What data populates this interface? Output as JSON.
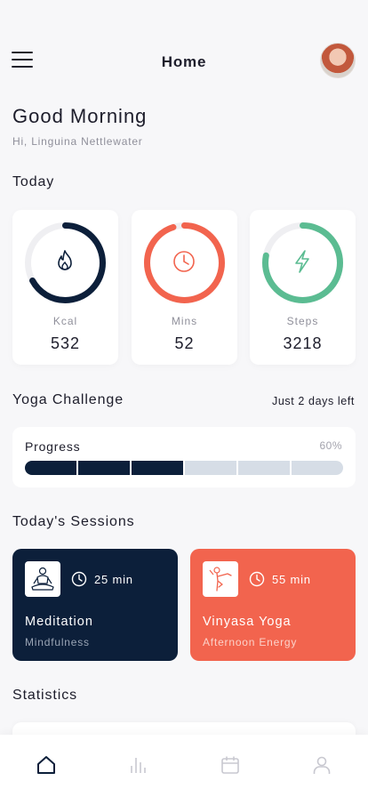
{
  "header": {
    "title": "Home"
  },
  "greeting": {
    "title": "Good Morning",
    "subtitle": "Hi, Linguina Nettlewater"
  },
  "today": {
    "title": "Today",
    "stats": [
      {
        "label": "Kcal",
        "value": "532",
        "icon": "flame-icon",
        "color": "#0c1f3a",
        "fill": 0.67
      },
      {
        "label": "Mins",
        "value": "52",
        "icon": "clock-icon",
        "color": "#f2644e",
        "fill": 0.95
      },
      {
        "label": "Steps",
        "value": "3218",
        "icon": "lightning-icon",
        "color": "#5bbc92",
        "fill": 0.78
      }
    ]
  },
  "challenge": {
    "title": "Yoga Challenge",
    "note": "Just 2 days left",
    "progress_label": "Progress",
    "progress_percent": "60%",
    "segments_total": 6,
    "segments_done": 3
  },
  "sessions": {
    "title": "Today's Sessions",
    "items": [
      {
        "name": "Meditation",
        "subtitle": "Mindfulness",
        "duration": "25 min",
        "icon": "meditation-icon",
        "color": "#0c1f3a"
      },
      {
        "name": "Vinyasa Yoga",
        "subtitle": "Afternoon Energy",
        "duration": "55 min",
        "icon": "yoga-pose-icon",
        "color": "#f2644e"
      }
    ]
  },
  "statistics": {
    "title": "Statistics"
  },
  "nav": {
    "items": [
      {
        "name": "home",
        "icon": "home-icon",
        "active": true
      },
      {
        "name": "stats",
        "icon": "bar-chart-icon",
        "active": false
      },
      {
        "name": "calendar",
        "icon": "calendar-icon",
        "active": false
      },
      {
        "name": "profile",
        "icon": "user-icon",
        "active": false
      }
    ]
  }
}
